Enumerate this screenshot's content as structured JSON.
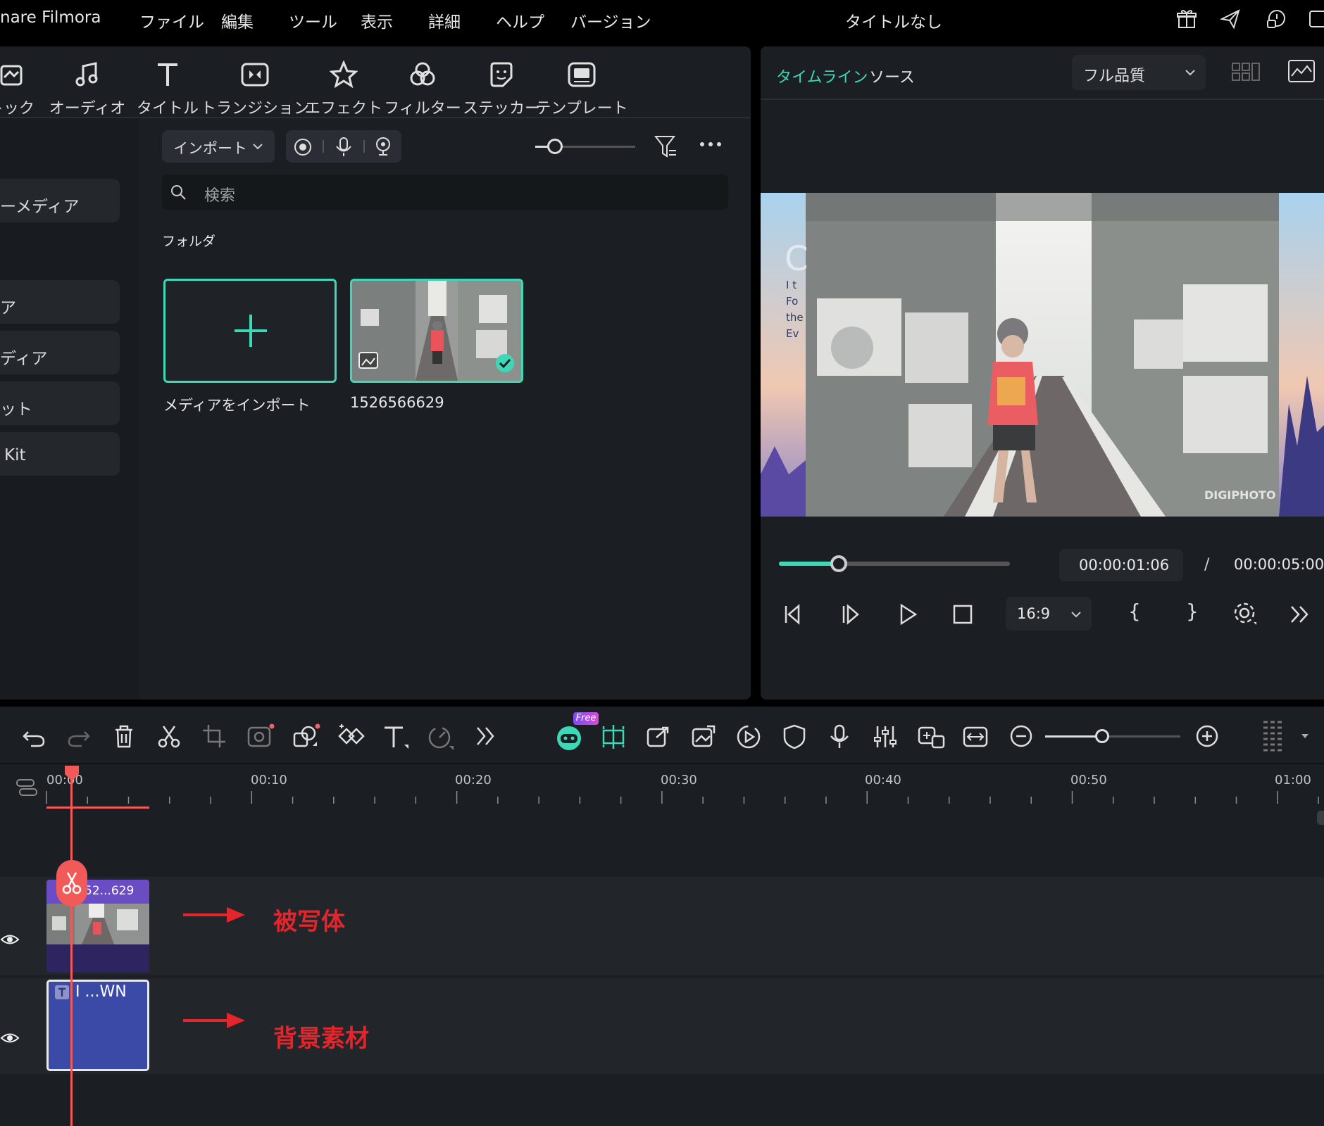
{
  "app": {
    "title": "nare Filmora",
    "document_title": "タイトルなし"
  },
  "menu": [
    "ファイル",
    "編集",
    "ツール",
    "表示",
    "詳細",
    "ヘルプ",
    "バージョン"
  ],
  "toolbar": [
    {
      "label": "トック",
      "icon": "stock-icon"
    },
    {
      "label": "オーディオ",
      "icon": "music-note-icon"
    },
    {
      "label": "タイトル",
      "icon": "title-t-icon"
    },
    {
      "label": "トランジション",
      "icon": "transition-icon"
    },
    {
      "label": "エフェクト",
      "icon": "effect-star-icon"
    },
    {
      "label": "フィルター",
      "icon": "filter-icon"
    },
    {
      "label": "ステッカー",
      "icon": "sticker-icon"
    },
    {
      "label": "テンプレート",
      "icon": "template-icon"
    }
  ],
  "sidebar": [
    "ーメディア",
    "ア",
    "ディア",
    "ット",
    "Kit"
  ],
  "media": {
    "import_label": "インポート",
    "search_placeholder": "検索",
    "folder_label": "フォルダ",
    "import_card_label": "メディアをインポート",
    "clip_label": "1526566629"
  },
  "preview": {
    "tab_timeline": "タイムライン",
    "tab_source": "ソース",
    "quality": "フル品質",
    "current_time": "00:00:01:06",
    "separator": "/",
    "total_time": "00:00:05:00",
    "aspect": "16:9",
    "progress_fraction": 0.26,
    "brace_open": "{",
    "brace_close": "}",
    "photo_watermark": "DIGIPHOTO",
    "left_overlay_text": [
      "I t",
      "Fo",
      "the",
      "Ev"
    ]
  },
  "timeline": {
    "free_badge": "Free",
    "ruler": [
      "00:00",
      "00:10",
      "00:20",
      "00:30",
      "00:40",
      "00:50",
      "01:00"
    ],
    "clip1_label": "52...629",
    "clip2_label": "I ...WN",
    "annotation1": "被写体",
    "annotation2": "背景素材",
    "zoom_fraction": 0.42
  },
  "colors": {
    "accent": "#3fd8b7",
    "playhead": "#f25a5a",
    "annotation": "#e3262b",
    "clip_purple": "#6a4cc4",
    "clip_blue": "#3b4aa6"
  }
}
